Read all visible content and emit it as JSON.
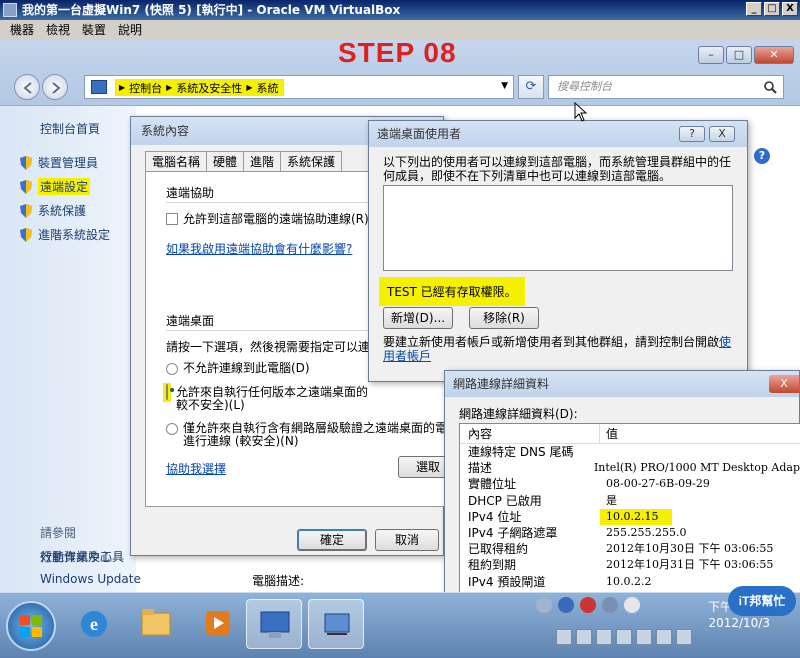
{
  "vbox": {
    "title": "我的第一台虛擬Win7 (快照 5) [執行中] - Oracle VM VirtualBox",
    "menu": [
      "機器",
      "檢視",
      "裝置",
      "說明"
    ],
    "window_buttons": [
      "_",
      "□",
      "X"
    ]
  },
  "annotation": {
    "step": "STEP 08"
  },
  "control_panel": {
    "breadcrumbs": [
      "控制台",
      "系統及安全性",
      "系統"
    ],
    "search_placeholder": "搜尋控制台",
    "sidebar": {
      "home": "控制台首頁",
      "items": [
        "裝置管理員",
        "遠端設定",
        "系統保護",
        "進階系統設定"
      ],
      "see_also_title": "請參閱",
      "see_also": [
        "行動作業中心",
        "Windows Update",
        "效能資訊及工具"
      ]
    },
    "computer_description": "電腦描述:"
  },
  "system_properties": {
    "title": "系統內容",
    "tabs": [
      "電腦名稱",
      "硬體",
      "進階",
      "系統保護"
    ],
    "remote_assistance_title": "遠端協助",
    "allow_assistance": "允許到這部電腦的遠端協助連線(R)",
    "assistance_link": "如果我啟用遠端協助會有什麼影響?",
    "remote_desktop_title": "遠端桌面",
    "remote_desktop_hint": "請按一下選項，然後視需要指定可以連",
    "option_disallow": "不允許連線到此電腦(D)",
    "option_any_1": "允許來自執行任何版本之遠端桌面的",
    "option_any_2": "較不安全)(L)",
    "option_nla_1": "僅允許來自執行含有網路層級驗證之遠端桌面的電",
    "option_nla_2": "進行連線 (較安全)(N)",
    "help_link": "協助我選擇",
    "select_button": "選取",
    "ok": "確定",
    "cancel": "取消"
  },
  "remote_users": {
    "title": "遠端桌面使用者",
    "help_btn": "?",
    "close_btn": "X",
    "description": "以下列出的使用者可以連線到這部電腦，而系統管理員群組中的任何成員，即使不在下列清單中也可以連線到這部電腦。",
    "access_message": "TEST 已經有存取權限。",
    "add": "新增(D)...",
    "remove": "移除(R)",
    "note_text": "要建立新使用者帳戶或新增使用者到其他群組，請到控制台開啟",
    "note_link": "使用者帳戶"
  },
  "network_details": {
    "title": "網路連線詳細資料",
    "close_btn": "X",
    "heading": "網路連線詳細資料(D):",
    "columns": [
      "內容",
      "值"
    ],
    "rows": [
      [
        "連線特定 DNS 尾碼",
        ""
      ],
      [
        "描述",
        "Intel(R) PRO/1000 MT Desktop Adap"
      ],
      [
        "實體位址",
        "08-00-27-6B-09-29"
      ],
      [
        "DHCP 已啟用",
        "是"
      ],
      [
        "IPv4 位址",
        "10.0.2.15"
      ],
      [
        "IPv4 子網路遮罩",
        "255.255.255.0"
      ],
      [
        "已取得租約",
        "2012年10月30日 下午 03:06:55"
      ],
      [
        "租約到期",
        "2012年10月31日 下午 03:06:55"
      ],
      [
        "IPv4 預設閘道",
        "10.0.2.2"
      ]
    ],
    "highlight_row": 4
  },
  "taskbar": {
    "time": "下午 03:30",
    "date": "2012/10/3"
  },
  "watermark": "iT邦幫忙",
  "colors": {
    "highlight": "#f5f000",
    "step": "#e0201e",
    "link": "#0645ad"
  }
}
